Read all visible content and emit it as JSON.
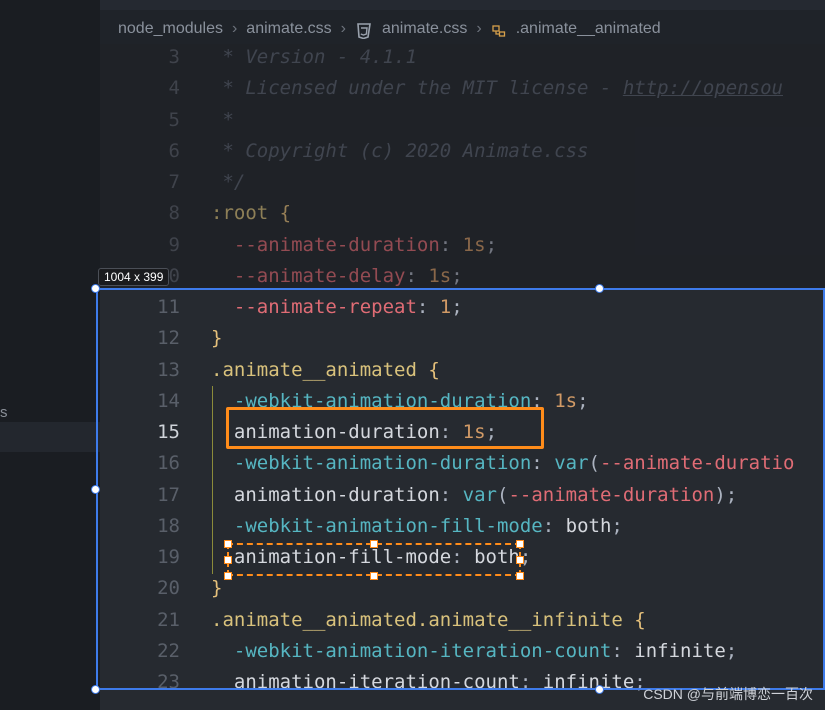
{
  "breadcrumb": {
    "items": [
      "node_modules",
      "animate.css",
      "animate.css",
      ".animate__animated"
    ]
  },
  "sidebar": {
    "fragment": "s"
  },
  "editor": {
    "active_line": "15",
    "lines": [
      {
        "num": "3",
        "parts": [
          {
            "t": " * Version - 4.1.1",
            "c": "comment"
          }
        ]
      },
      {
        "num": "4",
        "parts": [
          {
            "t": " * Licensed under the MIT license - ",
            "c": "comment"
          },
          {
            "t": "http://opensou",
            "c": "link"
          }
        ]
      },
      {
        "num": "5",
        "parts": [
          {
            "t": " *",
            "c": "comment"
          }
        ]
      },
      {
        "num": "6",
        "parts": [
          {
            "t": " * Copyright (c) 2020 Animate.css",
            "c": "comment"
          }
        ]
      },
      {
        "num": "7",
        "parts": [
          {
            "t": " */",
            "c": "comment"
          }
        ]
      },
      {
        "num": "8",
        "parts": [
          {
            "t": ":root ",
            "c": "sel"
          },
          {
            "t": "{",
            "c": "brace"
          }
        ]
      },
      {
        "num": "9",
        "parts": [
          {
            "t": "  --animate-duration",
            "c": "var"
          },
          {
            "t": ": ",
            "c": "punc"
          },
          {
            "t": "1s",
            "c": "num"
          },
          {
            "t": ";",
            "c": "punc"
          }
        ]
      },
      {
        "num": "10",
        "parts": [
          {
            "t": "  --animate-delay",
            "c": "var"
          },
          {
            "t": ": ",
            "c": "punc"
          },
          {
            "t": "1s",
            "c": "num"
          },
          {
            "t": ";",
            "c": "punc"
          }
        ]
      },
      {
        "num": "11",
        "parts": [
          {
            "t": "  --animate-repeat",
            "c": "var"
          },
          {
            "t": ": ",
            "c": "punc"
          },
          {
            "t": "1",
            "c": "num"
          },
          {
            "t": ";",
            "c": "punc"
          }
        ]
      },
      {
        "num": "12",
        "parts": [
          {
            "t": "}",
            "c": "brace"
          }
        ]
      },
      {
        "num": "13",
        "parts": [
          {
            "t": ".animate__animated ",
            "c": "sel"
          },
          {
            "t": "{",
            "c": "brace"
          }
        ]
      },
      {
        "num": "14",
        "parts": [
          {
            "t": "  -webkit-animation-duration",
            "c": "prop"
          },
          {
            "t": ": ",
            "c": "punc"
          },
          {
            "t": "1s",
            "c": "num"
          },
          {
            "t": ";",
            "c": "punc"
          }
        ]
      },
      {
        "num": "15",
        "parts": [
          {
            "t": "  animation-duration",
            "c": "prop2"
          },
          {
            "t": ": ",
            "c": "punc"
          },
          {
            "t": "1s",
            "c": "num"
          },
          {
            "t": ";",
            "c": "punc"
          }
        ]
      },
      {
        "num": "16",
        "parts": [
          {
            "t": "  -webkit-animation-duration",
            "c": "prop"
          },
          {
            "t": ": ",
            "c": "punc"
          },
          {
            "t": "var",
            "c": "fn"
          },
          {
            "t": "(",
            "c": "punc"
          },
          {
            "t": "--animate-duratio",
            "c": "var"
          }
        ]
      },
      {
        "num": "17",
        "parts": [
          {
            "t": "  animation-duration",
            "c": "prop2"
          },
          {
            "t": ": ",
            "c": "punc"
          },
          {
            "t": "var",
            "c": "fn"
          },
          {
            "t": "(",
            "c": "punc"
          },
          {
            "t": "--animate-duration",
            "c": "var"
          },
          {
            "t": ");",
            "c": "punc"
          }
        ]
      },
      {
        "num": "18",
        "parts": [
          {
            "t": "  -webkit-animation-fill-mode",
            "c": "prop"
          },
          {
            "t": ": ",
            "c": "punc"
          },
          {
            "t": "both",
            "c": "prop2"
          },
          {
            "t": ";",
            "c": "punc"
          }
        ]
      },
      {
        "num": "19",
        "parts": [
          {
            "t": "  animation-fill-mode",
            "c": "prop2"
          },
          {
            "t": ": ",
            "c": "punc"
          },
          {
            "t": "both",
            "c": "prop2"
          },
          {
            "t": ";",
            "c": "punc"
          }
        ]
      },
      {
        "num": "20",
        "parts": [
          {
            "t": "}",
            "c": "brace"
          }
        ]
      },
      {
        "num": "21",
        "parts": [
          {
            "t": ".animate__animated.animate__infinite ",
            "c": "sel"
          },
          {
            "t": "{",
            "c": "brace"
          }
        ]
      },
      {
        "num": "22",
        "parts": [
          {
            "t": "  -webkit-animation-iteration-count",
            "c": "prop"
          },
          {
            "t": ": ",
            "c": "punc"
          },
          {
            "t": "infinite",
            "c": "prop2"
          },
          {
            "t": ";",
            "c": "punc"
          }
        ]
      },
      {
        "num": "23",
        "parts": [
          {
            "t": "  animation-iteration-count",
            "c": "prop2"
          },
          {
            "t": ": ",
            "c": "punc"
          },
          {
            "t": "infinite",
            "c": "prop2"
          },
          {
            "t": ";",
            "c": "punc"
          }
        ]
      }
    ]
  },
  "screenshot_tool": {
    "size_label": "1004 x 399"
  },
  "watermark": "CSDN @与前端博恋一百次",
  "colors": {
    "selection": "#3e7bea",
    "highlight": "#ff8c1a",
    "background": "#262a30"
  }
}
